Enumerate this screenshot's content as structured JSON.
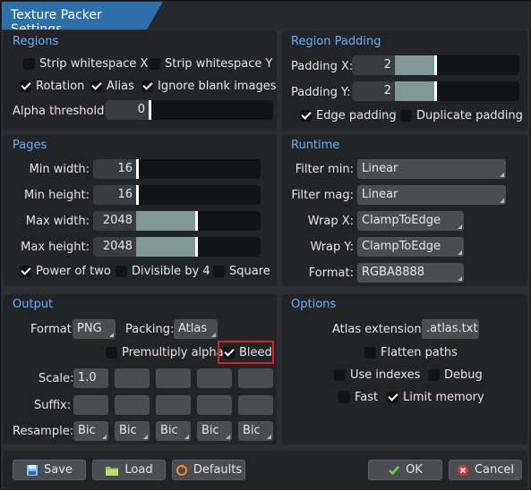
{
  "window": {
    "title": "Texture Packer Settings"
  },
  "regions": {
    "title": "Regions",
    "strip_x": "Strip whitespace X",
    "strip_y": "Strip whitespace Y",
    "rotation": "Rotation",
    "alias": "Alias",
    "ignore_blank": "Ignore blank images",
    "alpha_label": "Alpha threshold:",
    "alpha_value": "0"
  },
  "region_padding": {
    "title": "Region Padding",
    "px_label": "Padding X:",
    "px_value": "2",
    "py_label": "Padding Y:",
    "py_value": "2",
    "edge": "Edge padding",
    "duplicate": "Duplicate padding"
  },
  "pages": {
    "title": "Pages",
    "min_w_label": "Min width:",
    "min_w": "16",
    "min_h_label": "Min height:",
    "min_h": "16",
    "max_w_label": "Max width:",
    "max_w": "2048",
    "max_h_label": "Max height:",
    "max_h": "2048",
    "pot": "Power of two",
    "div4": "Divisible by 4",
    "square": "Square"
  },
  "runtime": {
    "title": "Runtime",
    "filter_min_label": "Filter min:",
    "filter_min": "Linear",
    "filter_mag_label": "Filter mag:",
    "filter_mag": "Linear",
    "wrap_x_label": "Wrap X:",
    "wrap_x": "ClampToEdge",
    "wrap_y_label": "Wrap Y:",
    "wrap_y": "ClampToEdge",
    "format_label": "Format:",
    "format": "RGBA8888"
  },
  "output": {
    "title": "Output",
    "format_label": "Format:",
    "format": "PNG",
    "packing_label": "Packing:",
    "packing": "Atlas",
    "premultiply": "Premultiply alpha",
    "bleed": "Bleed",
    "scale_label": "Scale:",
    "scale_values": [
      "1.0",
      "",
      "",
      "",
      ""
    ],
    "suffix_label": "Suffix:",
    "resample_label": "Resample:",
    "resample_values": [
      "Bic",
      "Bic",
      "Bic",
      "Bic",
      "Bic"
    ]
  },
  "options": {
    "title": "Options",
    "atlas_ext_label": "Atlas extension:",
    "atlas_ext": ".atlas.txt",
    "flatten": "Flatten paths",
    "indexes": "Use indexes",
    "debug": "Debug",
    "fast": "Fast",
    "limit_memory": "Limit memory"
  },
  "buttons": {
    "save": "Save",
    "load": "Load",
    "defaults": "Defaults",
    "ok": "OK",
    "cancel": "Cancel"
  }
}
